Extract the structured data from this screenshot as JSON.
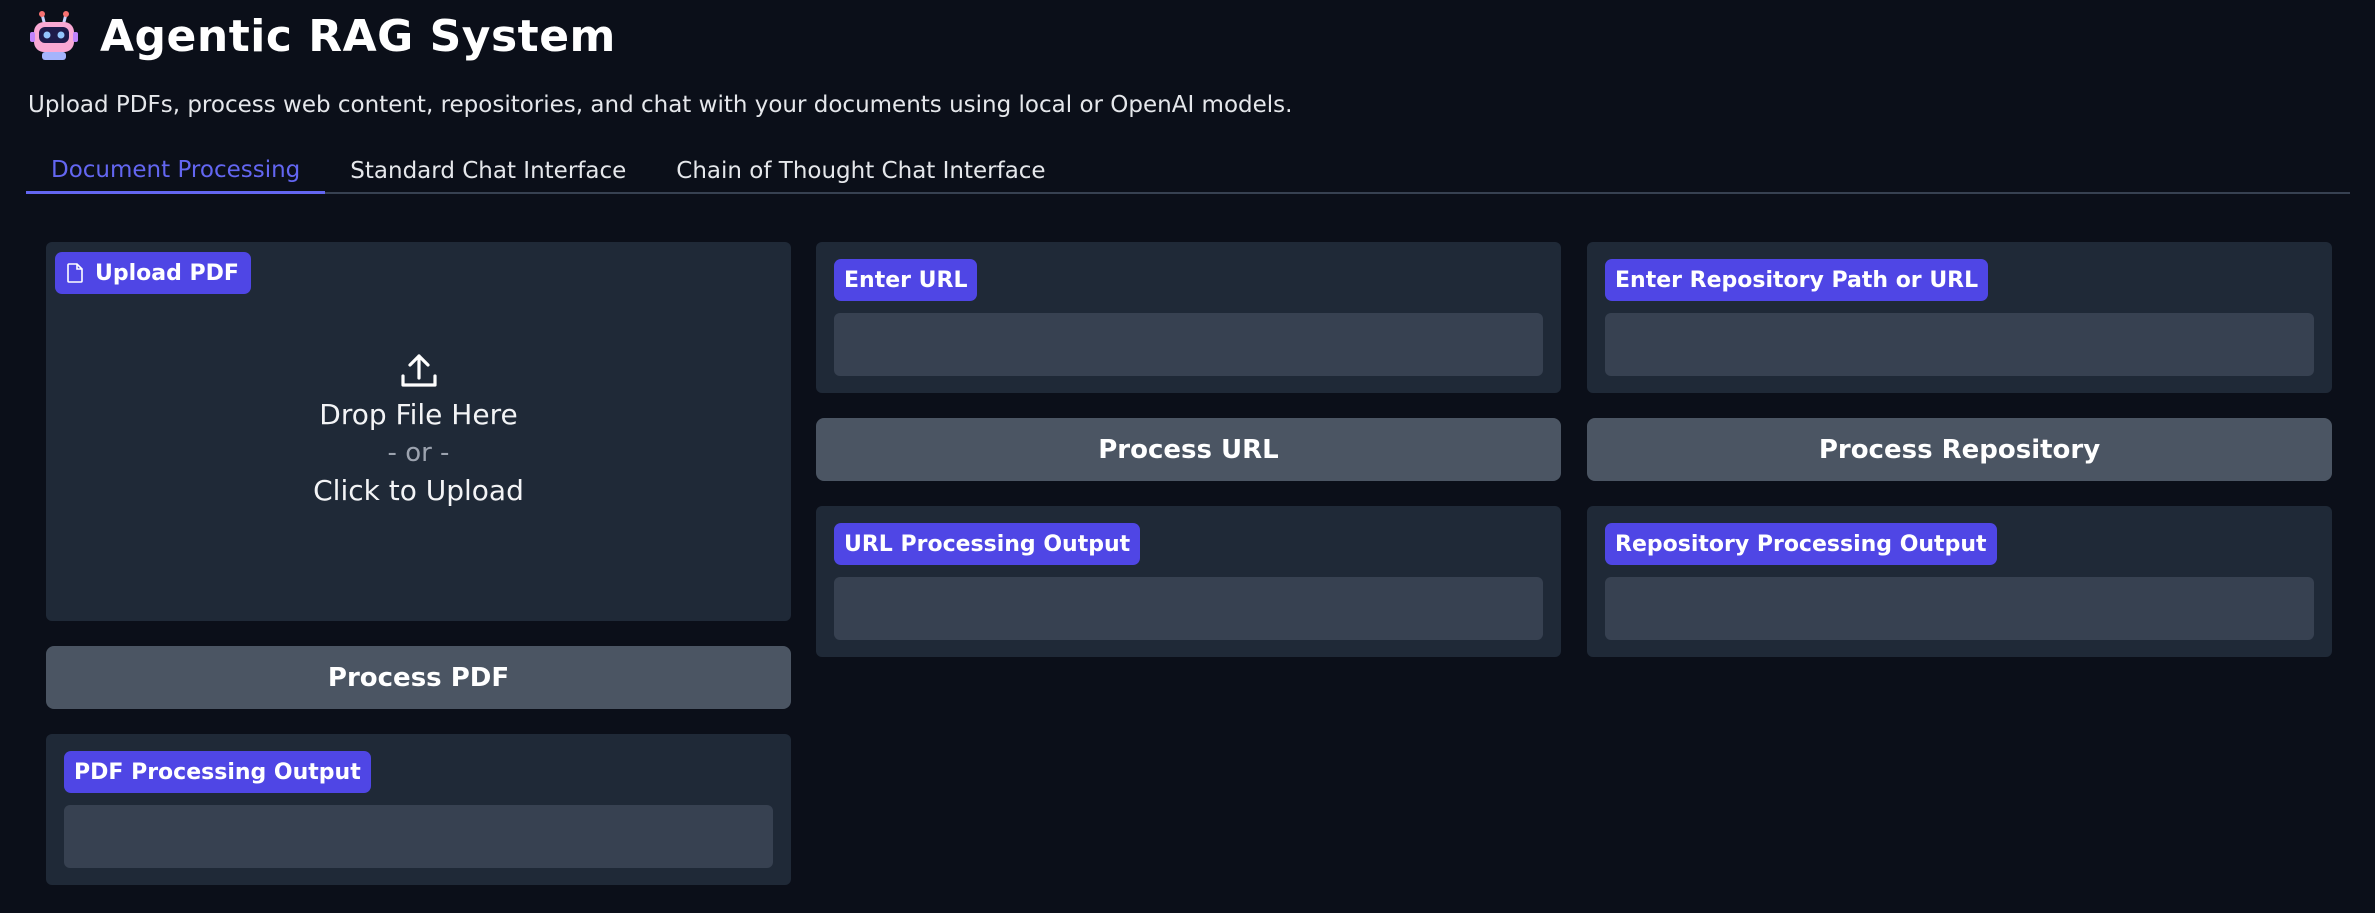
{
  "app": {
    "title": "Agentic RAG System",
    "subtitle": "Upload PDFs, process web content, repositories, and chat with your documents using local or OpenAI models.",
    "icon": "robot-icon"
  },
  "tabs": [
    {
      "label": "Document Processing",
      "active": true
    },
    {
      "label": "Standard Chat Interface",
      "active": false
    },
    {
      "label": "Chain of Thought Chat Interface",
      "active": false
    }
  ],
  "pdf": {
    "upload_label": "Upload PDF",
    "drop_text": "Drop File Here",
    "or_text": "- or -",
    "click_text": "Click to Upload",
    "button": "Process PDF",
    "output_label": "PDF Processing Output",
    "output_value": ""
  },
  "url": {
    "input_label": "Enter URL",
    "input_value": "",
    "button": "Process URL",
    "output_label": "URL Processing Output",
    "output_value": ""
  },
  "repo": {
    "input_label": "Enter Repository Path or URL",
    "input_value": "",
    "button": "Process Repository",
    "output_label": "Repository Processing Output",
    "output_value": ""
  },
  "colors": {
    "background": "#0b0f19",
    "panel": "#1f2937",
    "field": "#374151",
    "button": "#4b5563",
    "accent": "#4f46e5",
    "active_tab": "#6366f1"
  }
}
